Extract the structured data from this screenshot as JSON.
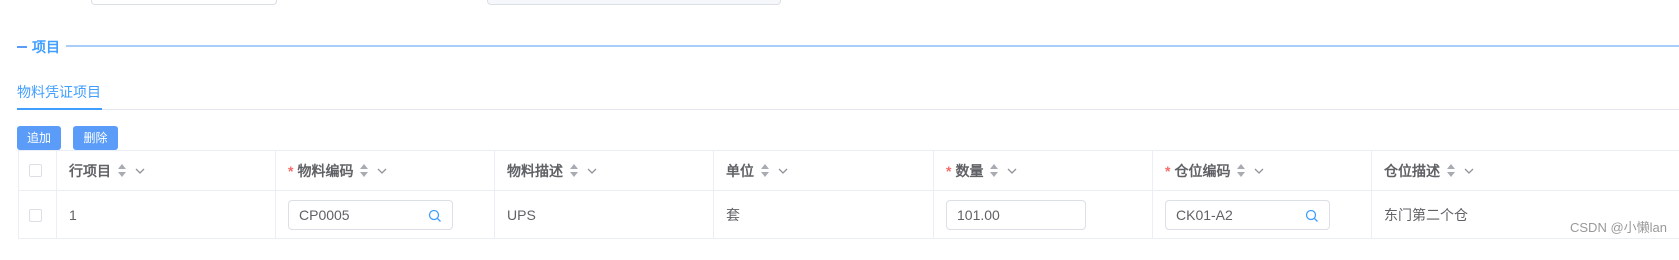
{
  "section": {
    "title": "项目"
  },
  "tabs": [
    {
      "label": "物料凭证项目",
      "active": true
    }
  ],
  "toolbar": {
    "add_label": "追加",
    "delete_label": "删除"
  },
  "table": {
    "columns": [
      {
        "label": "行项目",
        "required": false
      },
      {
        "label": "物料编码",
        "required": true
      },
      {
        "label": "物料描述",
        "required": false
      },
      {
        "label": "单位",
        "required": false
      },
      {
        "label": "数量",
        "required": true
      },
      {
        "label": "仓位编码",
        "required": true
      },
      {
        "label": "仓位描述",
        "required": false
      }
    ],
    "rows": [
      {
        "line_item": "1",
        "material_code": "CP0005",
        "material_desc": "UPS",
        "unit": "套",
        "quantity": "101.00",
        "bin_code": "CK01-A2",
        "bin_desc": "东门第二个仓"
      }
    ]
  },
  "required_mark": "*",
  "watermark": "CSDN @小懒lan",
  "colors": {
    "accent": "#409eff",
    "button": "#5a9cf8",
    "required": "#f56c6c",
    "border": "#ebeef5"
  },
  "icons": [
    "search-icon",
    "sort-icon",
    "chevron-down-icon",
    "checkbox-icon"
  ]
}
